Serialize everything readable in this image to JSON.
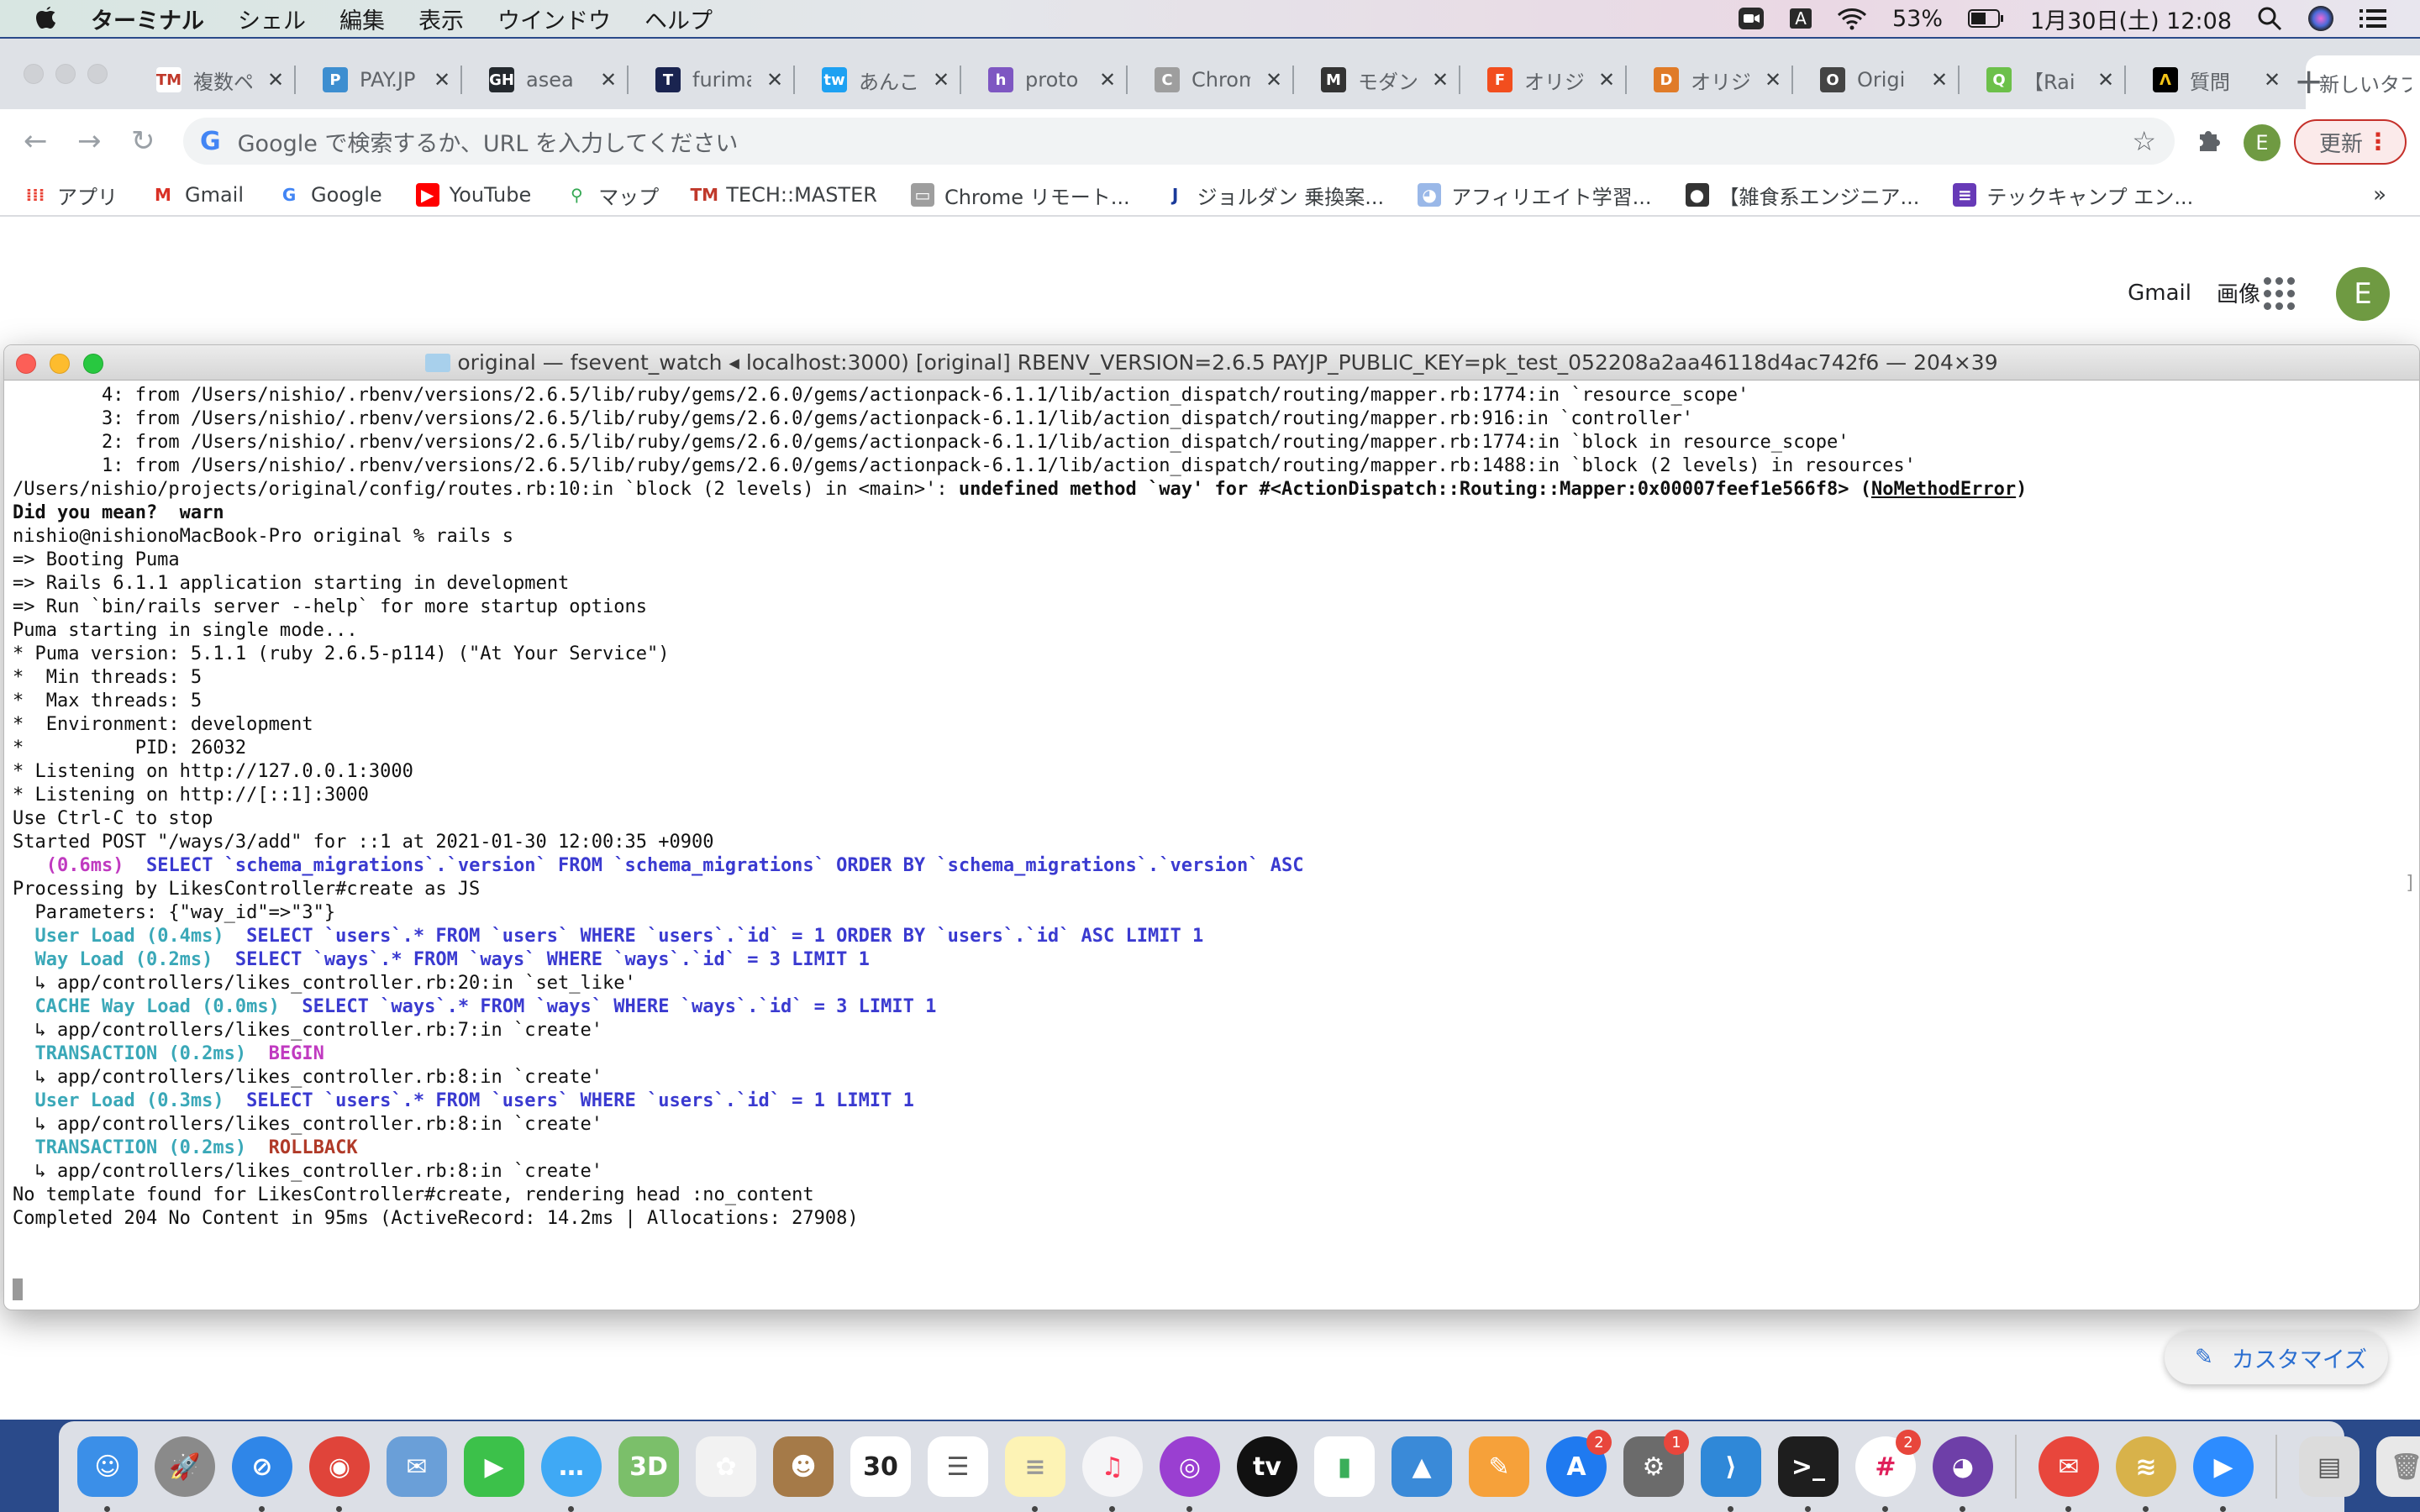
{
  "menubar": {
    "app_name": "ターミナル",
    "menus": [
      "シェル",
      "編集",
      "表示",
      "ウインドウ",
      "ヘルプ"
    ],
    "battery_percent": "53%",
    "datetime": "1月30日(土)  12:08",
    "input_source": "A"
  },
  "browser": {
    "tabs": [
      {
        "title": "複数ペ",
        "favicon": "TM",
        "color": "#ffffff",
        "fg": "#c0392b"
      },
      {
        "title": "PAY.JP",
        "favicon": "P",
        "color": "#3d8ed0",
        "fg": "#ffffff"
      },
      {
        "title": "asea",
        "favicon": "GH",
        "color": "#24292e",
        "fg": "#ffffff"
      },
      {
        "title": "furima",
        "favicon": "T",
        "color": "#1a2450",
        "fg": "#ffffff"
      },
      {
        "title": "あんこ",
        "favicon": "tw",
        "color": "#1da1f2",
        "fg": "#ffffff"
      },
      {
        "title": "proto",
        "favicon": "h",
        "color": "#7e57c2",
        "fg": "#ffffff"
      },
      {
        "title": "Chrome",
        "favicon": "C",
        "color": "#9e9e9e",
        "fg": "#ffffff"
      },
      {
        "title": "モダン",
        "favicon": "M",
        "color": "#333333",
        "fg": "#ffffff"
      },
      {
        "title": "オリジ",
        "favicon": "F",
        "color": "#f24e1e",
        "fg": "#ffffff"
      },
      {
        "title": "オリジ",
        "favicon": "D",
        "color": "#e07b28",
        "fg": "#ffffff"
      },
      {
        "title": "Origi",
        "favicon": "O",
        "color": "#444444",
        "fg": "#ffffff"
      },
      {
        "title": "【Rai",
        "favicon": "Q",
        "color": "#6cc04a",
        "fg": "#ffffff"
      },
      {
        "title": "質問",
        "favicon": "Λ",
        "color": "#000000",
        "fg": "#f5c518"
      },
      {
        "title": "新しいタブ",
        "favicon": "",
        "color": "",
        "fg": "",
        "active": true
      }
    ],
    "omnibox_placeholder": "Google で検索するか、URL を入力してください",
    "profile_initial": "E",
    "update_label": "更新",
    "bookmarks": [
      {
        "label": "アプリ",
        "icon": "apps-grid-icon"
      },
      {
        "label": "Gmail",
        "icon": "gmail-icon"
      },
      {
        "label": "Google",
        "icon": "google-icon"
      },
      {
        "label": "YouTube",
        "icon": "youtube-icon"
      },
      {
        "label": "マップ",
        "icon": "maps-icon"
      },
      {
        "label": "TECH::MASTER",
        "icon": "techmaster-icon"
      },
      {
        "label": "Chrome リモート...",
        "icon": "chrome-remote-icon"
      },
      {
        "label": "ジョルダン  乗換案...",
        "icon": "jorudan-icon"
      },
      {
        "label": "アフィリエイト学習...",
        "icon": "duck-icon"
      },
      {
        "label": "【雑食系エンジニア...",
        "icon": "gorilla-icon"
      },
      {
        "label": "テックキャンプ エン...",
        "icon": "forms-icon"
      }
    ],
    "bookmarks_more": "»",
    "page": {
      "links": [
        "Gmail",
        "画像"
      ],
      "avatar_initial": "E",
      "customize_label": "カスタマイズ"
    }
  },
  "terminal": {
    "title": "original — fsevent_watch ◂ localhost:3000) [original] RBENV_VERSION=2.6.5 PAYJP_PUBLIC_KEY=pk_test_052208a2aa46118d4ac742f6 — 204×39",
    "lines": [
      [
        {
          "t": "        4: from /Users/nishio/.rbenv/versions/2.6.5/lib/ruby/gems/2.6.0/gems/actionpack-6.1.1/lib/action_dispatch/routing/mapper.rb:1774:in `resource_scope'"
        }
      ],
      [
        {
          "t": "        3: from /Users/nishio/.rbenv/versions/2.6.5/lib/ruby/gems/2.6.0/gems/actionpack-6.1.1/lib/action_dispatch/routing/mapper.rb:916:in `controller'"
        }
      ],
      [
        {
          "t": "        2: from /Users/nishio/.rbenv/versions/2.6.5/lib/ruby/gems/2.6.0/gems/actionpack-6.1.1/lib/action_dispatch/routing/mapper.rb:1774:in `block in resource_scope'"
        }
      ],
      [
        {
          "t": "        1: from /Users/nishio/.rbenv/versions/2.6.5/lib/ruby/gems/2.6.0/gems/actionpack-6.1.1/lib/action_dispatch/routing/mapper.rb:1488:in `block (2 levels) in resources'"
        }
      ],
      [
        {
          "t": "/Users/nishio/projects/original/config/routes.rb:10:in `block (2 levels) in <main>': "
        },
        {
          "t": "undefined method `way' for #<ActionDispatch::Routing::Mapper:0x00007feef1e566f8> (",
          "c": "b"
        },
        {
          "t": "NoMethodError",
          "c": "b u"
        },
        {
          "t": ")",
          "c": "b"
        }
      ],
      [
        {
          "t": "Did you mean?  warn",
          "c": "b"
        }
      ],
      [
        {
          "t": "nishio@nishionoMacBook-Pro original % rails s"
        }
      ],
      [
        {
          "t": "=> Booting Puma"
        }
      ],
      [
        {
          "t": "=> Rails 6.1.1 application starting in development"
        }
      ],
      [
        {
          "t": "=> Run `bin/rails server --help` for more startup options"
        }
      ],
      [
        {
          "t": "Puma starting in single mode..."
        }
      ],
      [
        {
          "t": "* Puma version: 5.1.1 (ruby 2.6.5-p114) (\"At Your Service\")"
        }
      ],
      [
        {
          "t": "*  Min threads: 5"
        }
      ],
      [
        {
          "t": "*  Max threads: 5"
        }
      ],
      [
        {
          "t": "*  Environment: development"
        }
      ],
      [
        {
          "t": "*          PID: 26032"
        }
      ],
      [
        {
          "t": "* Listening on http://127.0.0.1:3000"
        }
      ],
      [
        {
          "t": "* Listening on http://[::1]:3000"
        }
      ],
      [
        {
          "t": "Use Ctrl-C to stop"
        }
      ],
      [
        {
          "t": "Started POST \"/ways/3/add\" for ::1 at 2021-01-30 12:00:35 +0900"
        }
      ],
      [
        {
          "t": "   "
        },
        {
          "t": "(0.6ms)",
          "c": "c-magenta"
        },
        {
          "t": "  "
        },
        {
          "t": "SELECT `schema_migrations`.`version` FROM `schema_migrations` ORDER BY `schema_migrations`.`version` ASC",
          "c": "c-blue"
        }
      ],
      [
        {
          "t": "Processing by LikesController#create as JS"
        }
      ],
      [
        {
          "t": "  Parameters: {\"way_id\"=>\"3\"}"
        }
      ],
      [
        {
          "t": "  "
        },
        {
          "t": "User Load (0.4ms)",
          "c": "c-cyan"
        },
        {
          "t": "  "
        },
        {
          "t": "SELECT `users`.* FROM `users` WHERE `users`.`id` = 1 ORDER BY `users`.`id` ASC LIMIT 1",
          "c": "c-blue"
        }
      ],
      [
        {
          "t": "  "
        },
        {
          "t": "Way Load (0.2ms)",
          "c": "c-cyan"
        },
        {
          "t": "  "
        },
        {
          "t": "SELECT `ways`.* FROM `ways` WHERE `ways`.`id` = 3 LIMIT 1",
          "c": "c-blue"
        }
      ],
      [
        {
          "t": "  ↳ app/controllers/likes_controller.rb:20:in `set_like'"
        }
      ],
      [
        {
          "t": "  "
        },
        {
          "t": "CACHE Way Load (0.0ms)",
          "c": "c-cyan"
        },
        {
          "t": "  "
        },
        {
          "t": "SELECT `ways`.* FROM `ways` WHERE `ways`.`id` = 3 LIMIT 1",
          "c": "c-blue"
        }
      ],
      [
        {
          "t": "  ↳ app/controllers/likes_controller.rb:7:in `create'"
        }
      ],
      [
        {
          "t": "  "
        },
        {
          "t": "TRANSACTION (0.2ms)",
          "c": "c-cyan"
        },
        {
          "t": "  "
        },
        {
          "t": "BEGIN",
          "c": "c-magenta"
        }
      ],
      [
        {
          "t": "  ↳ app/controllers/likes_controller.rb:8:in `create'"
        }
      ],
      [
        {
          "t": "  "
        },
        {
          "t": "User Load (0.3ms)",
          "c": "c-cyan"
        },
        {
          "t": "  "
        },
        {
          "t": "SELECT `users`.* FROM `users` WHERE `users`.`id` = 1 LIMIT 1",
          "c": "c-blue"
        }
      ],
      [
        {
          "t": "  ↳ app/controllers/likes_controller.rb:8:in `create'"
        }
      ],
      [
        {
          "t": "  "
        },
        {
          "t": "TRANSACTION (0.2ms)",
          "c": "c-cyan"
        },
        {
          "t": "  "
        },
        {
          "t": "ROLLBACK",
          "c": "c-red"
        }
      ],
      [
        {
          "t": "  ↳ app/controllers/likes_controller.rb:8:in `create'"
        }
      ],
      [
        {
          "t": "No template found for LikesController#create, rendering head :no_content"
        }
      ],
      [
        {
          "t": "Completed 204 No Content in 95ms (ActiveRecord: 14.2ms | Allocations: 27908)"
        }
      ],
      [
        {
          "t": ""
        }
      ],
      [
        {
          "t": ""
        }
      ]
    ]
  },
  "dock": {
    "items": [
      {
        "name": "finder",
        "glyph": "☺",
        "bg": "#3b8fe8",
        "running": true
      },
      {
        "name": "launchpad",
        "glyph": "🚀",
        "bg": "#8a8a8a",
        "round": true
      },
      {
        "name": "safari",
        "glyph": "⊘",
        "bg": "#2f86e8",
        "round": true,
        "running": true
      },
      {
        "name": "chrome",
        "glyph": "◉",
        "bg": "#e0443a",
        "round": true,
        "running": true
      },
      {
        "name": "mail-stamp",
        "glyph": "✉",
        "bg": "#6a9fd8"
      },
      {
        "name": "facetime",
        "glyph": "▶",
        "bg": "#3cc14a"
      },
      {
        "name": "messages",
        "glyph": "…",
        "bg": "#3fa9f5",
        "round": true,
        "running": true
      },
      {
        "name": "maps",
        "glyph": "3D",
        "bg": "#7bbf6a"
      },
      {
        "name": "photos",
        "glyph": "✿",
        "bg": "#f2f2f2"
      },
      {
        "name": "contacts",
        "glyph": "☻",
        "bg": "#a57a48"
      },
      {
        "name": "calendar",
        "glyph": "30",
        "bg": "#ffffff",
        "fg": "#222222"
      },
      {
        "name": "reminders",
        "glyph": "☰",
        "bg": "#ffffff",
        "fg": "#555555"
      },
      {
        "name": "notes",
        "glyph": "≡",
        "bg": "#fdf3b5",
        "fg": "#999999",
        "running": true
      },
      {
        "name": "music",
        "glyph": "♫",
        "bg": "#f5f5f7",
        "fg": "#fa3a5a",
        "round": true,
        "running": true
      },
      {
        "name": "podcasts",
        "glyph": "◎",
        "bg": "#9a3fd1",
        "round": true,
        "running": true
      },
      {
        "name": "apple-tv",
        "glyph": "tv",
        "bg": "#111111",
        "round": true
      },
      {
        "name": "numbers",
        "glyph": "▮",
        "bg": "#ffffff",
        "fg": "#3aae5a"
      },
      {
        "name": "keynote",
        "glyph": "▲",
        "bg": "#3a8ad8"
      },
      {
        "name": "pages",
        "glyph": "✎",
        "bg": "#f6a13a"
      },
      {
        "name": "app-store",
        "glyph": "A",
        "bg": "#1f7af0",
        "round": true,
        "badge": "2"
      },
      {
        "name": "system-preferences",
        "glyph": "⚙",
        "bg": "#6b6b6b",
        "badge": "1"
      },
      {
        "name": "vscode",
        "glyph": "⟩",
        "bg": "#2f88d8",
        "running": true
      },
      {
        "name": "terminal",
        "glyph": ">_",
        "bg": "#1e1e1e",
        "running": true
      },
      {
        "name": "slack",
        "glyph": "#",
        "bg": "#ffffff",
        "fg": "#e01e5a",
        "round": true,
        "badge": "2",
        "running": true
      },
      {
        "name": "github-desktop",
        "glyph": "◕",
        "bg": "#6e3fa8",
        "round": true,
        "running": true
      },
      {
        "sep": true
      },
      {
        "name": "spark-mail",
        "glyph": "✉",
        "bg": "#e8463c",
        "round": true,
        "running": true
      },
      {
        "name": "sequel-pro",
        "glyph": "≋",
        "bg": "#d8b24a",
        "round": true,
        "running": true
      },
      {
        "name": "zoom",
        "glyph": "▶",
        "bg": "#2d8cff",
        "round": true,
        "running": true
      },
      {
        "sep": true
      },
      {
        "name": "downloads-stack",
        "glyph": "▤",
        "bg": "#dcdcdc",
        "fg": "#555555"
      },
      {
        "name": "trash",
        "glyph": "🗑",
        "bg": "#e8e8e8",
        "fg": "#888888"
      }
    ]
  }
}
